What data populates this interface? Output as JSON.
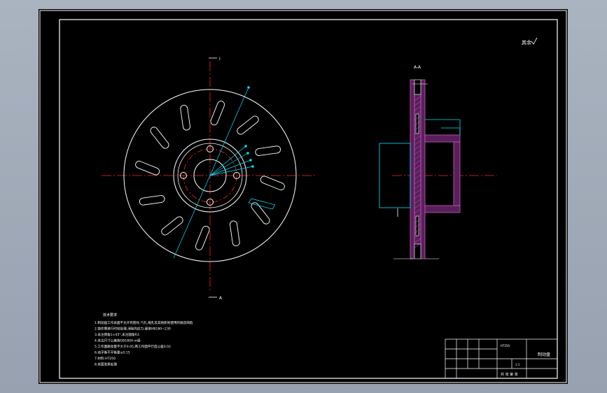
{
  "colors": {
    "background": "#000000",
    "frame": "#ffffff",
    "centerline": "#ff2020",
    "dimension": "#00e5ff",
    "hatch": "#b04aa8",
    "hatch_fill": "#5a1f5a"
  },
  "drawing": {
    "roughness_symbol": "其余",
    "section_top_label": "I",
    "section_bottom_label": "A",
    "section_view_label": "A-A",
    "tech_req_title": "技术要求",
    "tech_req_lines": [
      "1.制动盘工作表面不允许有裂纹,气孔,缩孔及其他影响使用的铸造缺陷",
      "2.铸件需进行时效处理,消除内应力,硬度HB180~230",
      "3.未注倒角1×45°,未注圆角R3",
      "4.未注尺寸公差按GB1804-m级",
      "5.工作面跳动量不大于0.05,两工作面平行度公差0.02",
      "6.动平衡不平衡量≤0.15",
      "7.材料:HT250",
      "8.表面发黑处理"
    ],
    "title_block": {
      "part_name": "制动盘",
      "material": "HT250",
      "scale": "1:1",
      "unit": "共 张 第 张"
    }
  }
}
